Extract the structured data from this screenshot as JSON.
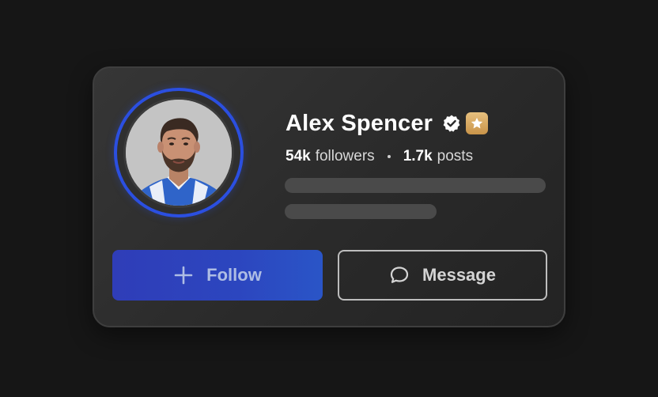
{
  "profile": {
    "name": "Alex Spencer",
    "followers_count": "54k",
    "followers_label": "followers",
    "posts_count": "1.7k",
    "posts_label": "posts",
    "verified": true,
    "badge": "star-badge"
  },
  "actions": {
    "follow_label": "Follow",
    "message_label": "Message"
  },
  "colors": {
    "accent": "#2b4fe0",
    "follow_button": "#2c46bf",
    "badge_gold": "#d9a862",
    "background": "#161616"
  },
  "icons": {
    "verified": "verified-check-icon",
    "badge": "star-icon",
    "follow": "plus-icon",
    "message": "chat-bubble-icon"
  }
}
